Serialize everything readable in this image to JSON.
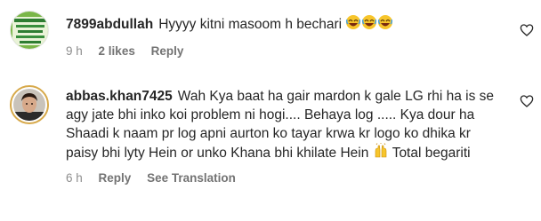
{
  "comments": [
    {
      "username": "7899abdullah",
      "text": "Hyyyy kitni masoom h bechari",
      "emoji": [
        "laughing-face",
        "laughing-face",
        "laughing-face"
      ],
      "time": "9 h",
      "likes": "2 likes",
      "reply": "Reply"
    },
    {
      "username": "abbas.khan7425",
      "text_1": "Wah Kya baat ha gair mardon k gale LG rhi ha is se agy jate bhi inko koi problem ni hogi.... Behaya log ..... Kya dour ha Shaadi k naam pr log apni aurton ko tayar krwa kr logo ko dhika kr paisy bhi lyty Hein or unko Khana bhi khilate Hein",
      "emoji": "raising-hands",
      "text_2": "Total begariti",
      "time": "6 h",
      "reply": "Reply",
      "see_translation": "See Translation"
    }
  ],
  "colors": {
    "text": "#262626",
    "meta": "#8e8e8e",
    "avatar_ring": "#d7a94a",
    "emoji_yellow": "#f7c52b"
  }
}
